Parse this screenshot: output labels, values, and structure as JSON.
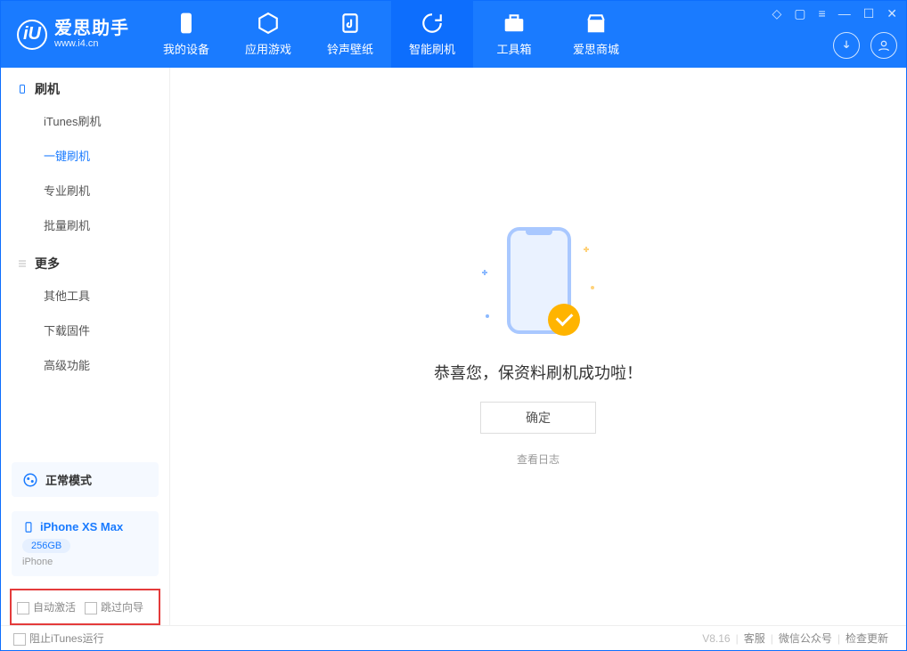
{
  "app": {
    "name": "爱思助手",
    "site": "www.i4.cn"
  },
  "tabs": {
    "device": "我的设备",
    "apps": "应用游戏",
    "ring": "铃声壁纸",
    "flash": "智能刷机",
    "tools": "工具箱",
    "store": "爱思商城"
  },
  "sidebar": {
    "section_flash": "刷机",
    "itunes_flash": "iTunes刷机",
    "one_click": "一键刷机",
    "pro_flash": "专业刷机",
    "batch_flash": "批量刷机",
    "section_more": "更多",
    "other_tools": "其他工具",
    "download_fw": "下载固件",
    "advanced": "高级功能"
  },
  "mode": {
    "label": "正常模式"
  },
  "device": {
    "name": "iPhone XS Max",
    "capacity": "256GB",
    "type": "iPhone"
  },
  "options": {
    "auto_activate": "自动激活",
    "skip_guide": "跳过向导"
  },
  "main": {
    "success": "恭喜您，保资料刷机成功啦！",
    "ok": "确定",
    "view_log": "查看日志"
  },
  "footer": {
    "block_itunes": "阻止iTunes运行",
    "version": "V8.16",
    "support": "客服",
    "wechat": "微信公众号",
    "update": "检查更新"
  }
}
